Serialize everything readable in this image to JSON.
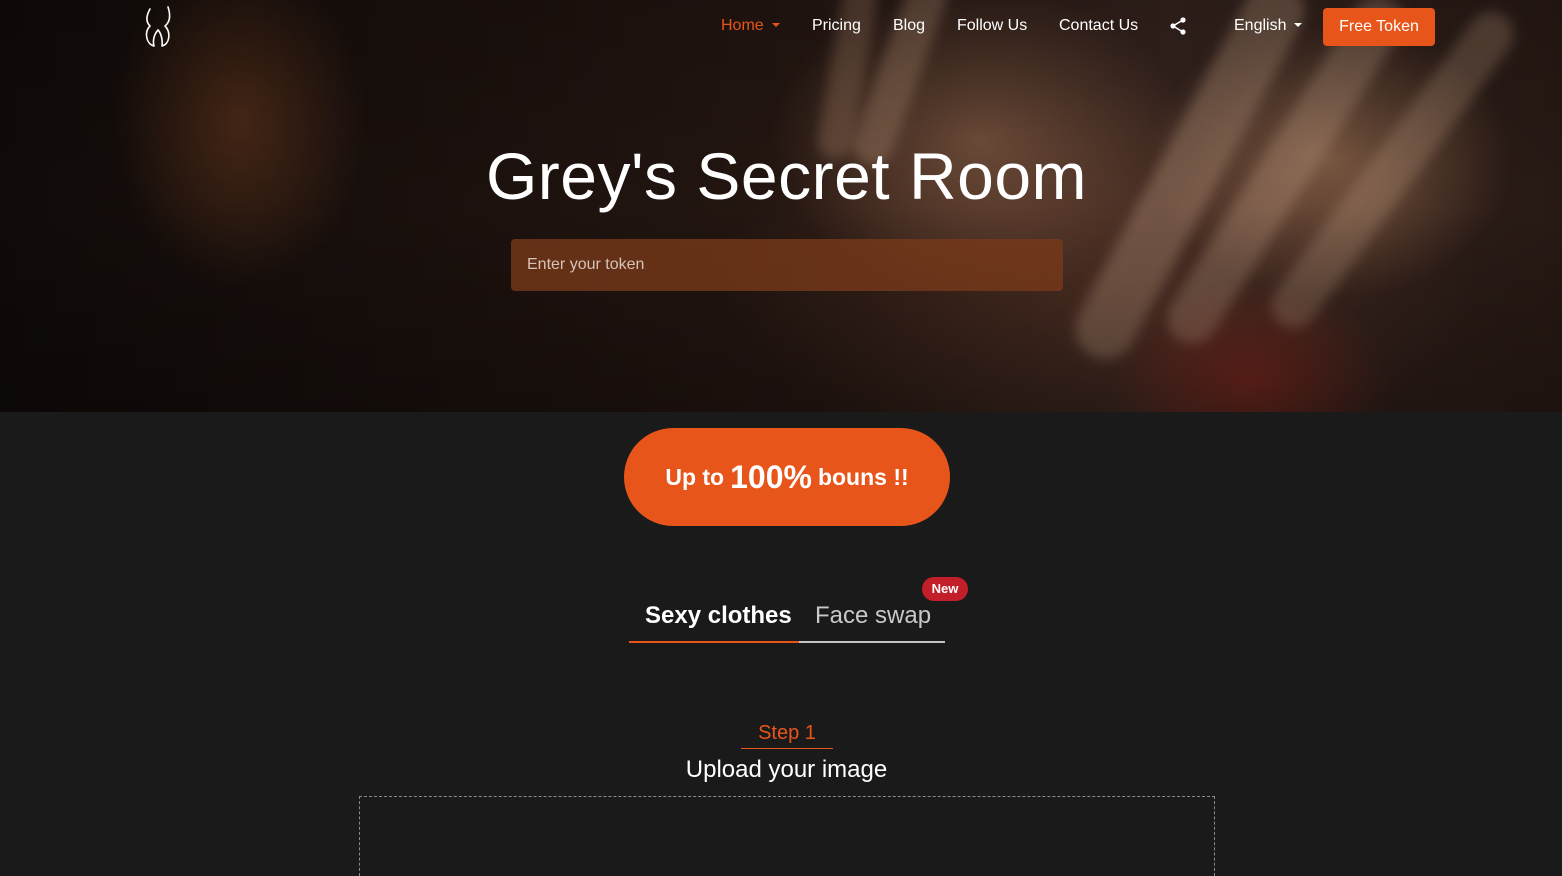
{
  "nav": {
    "items": [
      {
        "label": "Home"
      },
      {
        "label": "Pricing"
      },
      {
        "label": "Blog"
      },
      {
        "label": "Follow Us"
      },
      {
        "label": "Contact Us"
      }
    ],
    "language": "English",
    "cta_label": "Free Token",
    "accent_color": "#e8551a"
  },
  "hero": {
    "title": "Grey's Secret Room",
    "token_placeholder": "Enter your token"
  },
  "bonus": {
    "prefix": "Up to",
    "amount": "100%",
    "suffix": "bouns !!"
  },
  "tabs": [
    {
      "label": "Sexy clothes",
      "selected": true
    },
    {
      "label": "Face swap",
      "selected": false,
      "badge": "New"
    }
  ],
  "upload": {
    "step_label": "Step 1",
    "title": "Upload your image"
  },
  "icons": [
    "devil-horns-logo-icon",
    "share-icon",
    "caret-down-icon"
  ]
}
